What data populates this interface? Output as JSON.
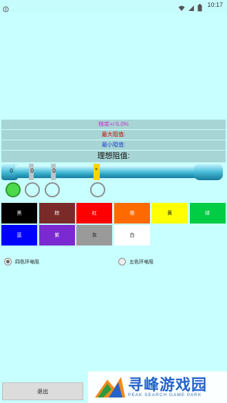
{
  "status_bar": {
    "time": "10:17"
  },
  "info": {
    "precision": "精度+/-5.0%",
    "max_value": "最大阻值:",
    "min_value": "最小阻值:",
    "ideal_value": "理想阻值:"
  },
  "resistor": {
    "band_labels": [
      "0",
      "0",
      "0",
      "*"
    ]
  },
  "colors": [
    {
      "label": "黑",
      "bg": "#000000",
      "fg": "#ffffff"
    },
    {
      "label": "棕",
      "bg": "#7b2a2a",
      "fg": "#ffffff"
    },
    {
      "label": "红",
      "bg": "#ff0000",
      "fg": "#ffffff"
    },
    {
      "label": "橙",
      "bg": "#ff6a00",
      "fg": "#ffffff"
    },
    {
      "label": "黄",
      "bg": "#ffff00",
      "fg": "#111111"
    },
    {
      "label": "绿",
      "bg": "#00cc44",
      "fg": "#ffffff"
    },
    {
      "label": "蓝",
      "bg": "#0000ff",
      "fg": "#ffffff"
    },
    {
      "label": "紫",
      "bg": "#7a2ad0",
      "fg": "#ffffff"
    },
    {
      "label": "灰",
      "bg": "#9a9a9a",
      "fg": "#111111"
    },
    {
      "label": "白",
      "bg": "#ffffff",
      "fg": "#111111"
    }
  ],
  "options": {
    "four_band": "四色环电阻",
    "five_band": "五色环电阻"
  },
  "exit_label": "退出",
  "watermark": {
    "main": "寻峰游戏园",
    "sub": "PEAK SEARCH GAME PARK"
  }
}
